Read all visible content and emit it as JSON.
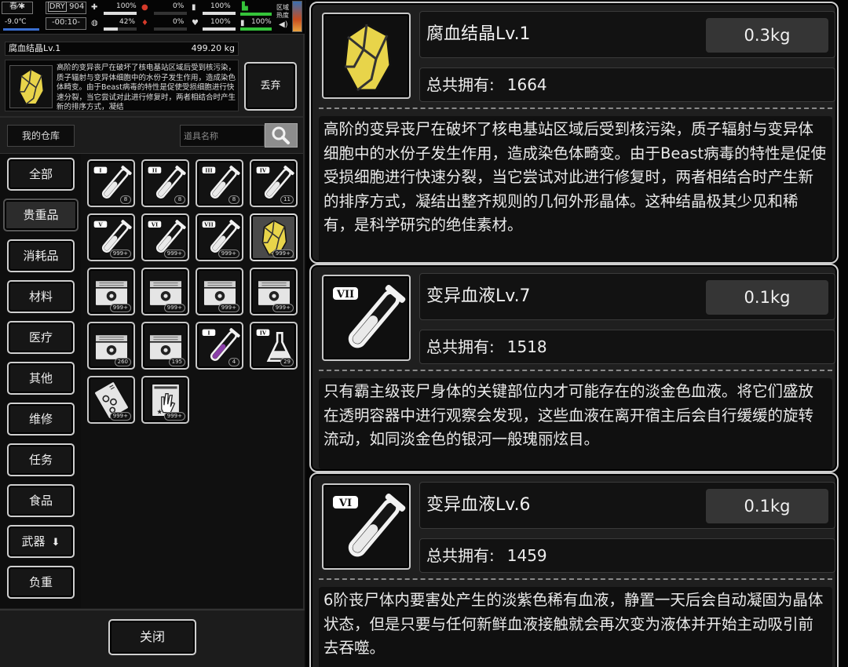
{
  "status": {
    "season": "春",
    "temperature": "-9.0℃",
    "dry_label": "DRY",
    "dry_value": "904",
    "clock": "-00:10-",
    "pct_medkit": "100%",
    "pct_stomach": "0%",
    "pct_battery1": "100%",
    "pct_brain": "42%",
    "pct_blood": "0%",
    "pct_heart": "100%",
    "pct_battery2": "100%",
    "zone_label_1": "区域",
    "zone_label_2": "热度",
    "bar_medkit": 1.0,
    "bar_stomach": 0.0,
    "bar_battery1": 1.0,
    "bar_brain": 0.42,
    "bar_blood": 0.0,
    "bar_heart": 1.0,
    "bar_battery2": 1.0
  },
  "selected": {
    "name": "腐血结晶Lv.1",
    "weight": "499.20 kg",
    "desc": "高阶的变异丧尸在破坏了核电基站区域后受到核污染，质子辐射与变异体细胞中的水份子发生作用，造成染色体畸变。由于Beast病毒的特性是促使受损细胞进行快速分裂，当它尝试对此进行修复时，两者相结合时产生新的排序方式，凝结",
    "discard_label": "丢弃"
  },
  "storage": {
    "title": "我的仓库",
    "search_placeholder": "道具名称"
  },
  "categories": [
    "全部",
    "贵重品",
    "消耗品",
    "材料",
    "医疗",
    "其他",
    "维修",
    "任务",
    "食品",
    "武器",
    "负重"
  ],
  "active_category": "贵重品",
  "grid_items": [
    {
      "icon": "tube-i-icon",
      "count": "8"
    },
    {
      "icon": "tube-ii-icon",
      "count": "8"
    },
    {
      "icon": "tube-iii-icon",
      "count": "8"
    },
    {
      "icon": "tube-iv-icon",
      "count": "11"
    },
    {
      "icon": "tube-v-icon",
      "count": "999+"
    },
    {
      "icon": "tube-vi-icon",
      "count": "999+"
    },
    {
      "icon": "tube-vii-icon",
      "count": "999+"
    },
    {
      "icon": "crystal-icon",
      "count": "999+"
    },
    {
      "icon": "crate-icon",
      "count": "999+"
    },
    {
      "icon": "crate-icon",
      "count": "999+"
    },
    {
      "icon": "crate-icon",
      "count": "999+"
    },
    {
      "icon": "crate-icon",
      "count": "999+"
    },
    {
      "icon": "crate-icon",
      "count": "260"
    },
    {
      "icon": "crate-icon",
      "count": "195"
    },
    {
      "icon": "purple-tube-icon",
      "count": "4"
    },
    {
      "icon": "flask-icon",
      "count": "29"
    },
    {
      "icon": "dna-card-icon",
      "count": "999+"
    },
    {
      "icon": "hand-card-icon",
      "count": "999+"
    }
  ],
  "close_label": "关闭",
  "cards": [
    {
      "name": "腐血结晶Lv.1",
      "weight": "0.3kg",
      "owned_label": "总共拥有:",
      "owned": "1664",
      "desc": "高阶的变异丧尸在破坏了核电基站区域后受到核污染，质子辐射与变异体细胞中的水份子发生作用，造成染色体畸变。由于Beast病毒的特性是促使受损细胞进行快速分裂，当它尝试对此进行修复时，两者相结合时产生新的排序方式，凝结出整齐规则的几何外形晶体。这种结晶极其少见和稀有，是科学研究的绝佳素材。",
      "icon": "crystal-icon"
    },
    {
      "name": "变异血液Lv.7",
      "weight": "0.1kg",
      "owned_label": "总共拥有:",
      "owned": "1518",
      "desc": "只有霸主级丧尸身体的关键部位内才可能存在的淡金色血液。将它们盛放在透明容器中进行观察会发现，这些血液在离开宿主后会自行缓缓的旋转流动，如同淡金色的银河一般瑰丽炫目。",
      "icon": "tube-vii-icon"
    },
    {
      "name": "变异血液Lv.6",
      "weight": "0.1kg",
      "owned_label": "总共拥有:",
      "owned": "1459",
      "desc": "6阶丧尸体内要害处产生的淡紫色稀有血液，静置一天后会自动凝固为晶体状态，但是只要与任何新鲜血液接触就会再次变为液体并开始主动吸引前去吞噬。",
      "icon": "tube-vi-icon"
    }
  ],
  "roman": {
    "tube-i-icon": "I",
    "tube-ii-icon": "II",
    "tube-iii-icon": "III",
    "tube-iv-icon": "IV",
    "tube-v-icon": "V",
    "tube-vi-icon": "VI",
    "tube-vii-icon": "VII",
    "purple-tube-icon": "I",
    "flask-icon": "IV"
  },
  "colors": {
    "crystal_gold": "#e8d44a",
    "purple_liquid": "#8a3fa8",
    "accent_green": "#35c43a",
    "accent_red": "#d43a2a"
  }
}
